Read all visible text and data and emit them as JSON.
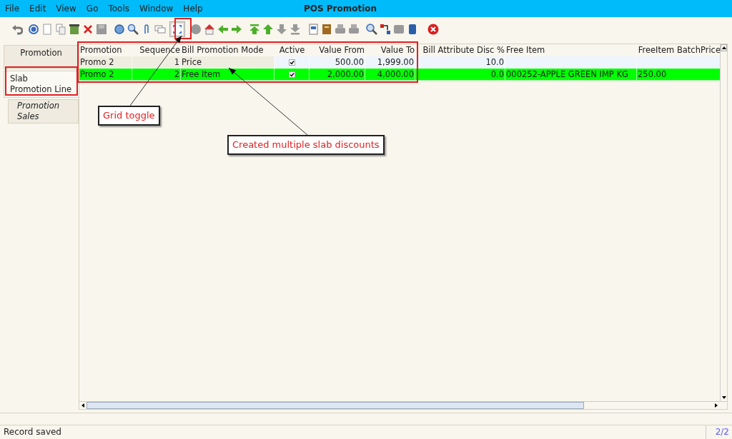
{
  "window": {
    "title": "POS Promotion"
  },
  "menu": [
    "File",
    "Edit",
    "View",
    "Go",
    "Tools",
    "Window",
    "Help"
  ],
  "tabs": [
    {
      "lines": [
        "Promotion"
      ],
      "selected": false,
      "kind": "tab"
    },
    {
      "lines": [
        "Slab",
        "Promotion Line"
      ],
      "selected": true,
      "kind": "tab"
    },
    {
      "lines": [
        "Promotion",
        "Sales"
      ],
      "selected": false,
      "kind": "subtab"
    }
  ],
  "table": {
    "columns": [
      "Promotion",
      "Sequence",
      "Bill Promotion Mode",
      "Active",
      "Value From",
      "Value To",
      "Bill Attribute Disc %",
      "Free Item",
      "FreeItem BatchPrice"
    ],
    "rows": [
      {
        "selected": false,
        "active": true,
        "cells": [
          "Promo 2",
          "1",
          "Price",
          "",
          "500.00",
          "1,999.00",
          "10.0",
          "",
          ""
        ]
      },
      {
        "selected": true,
        "active": true,
        "cells": [
          "Promo 2",
          "2",
          "Free Item",
          "",
          "2,000.00",
          "4,000.00",
          "0.0",
          "000252-APPLE GREEN IMP KG",
          "250.00"
        ]
      }
    ]
  },
  "annotations": [
    {
      "kind": "callout",
      "text": "Grid toggle"
    },
    {
      "kind": "callout",
      "text": "Created multiple slab discounts"
    }
  ],
  "status_bar": {
    "message": "Record saved",
    "record": "2/2"
  }
}
